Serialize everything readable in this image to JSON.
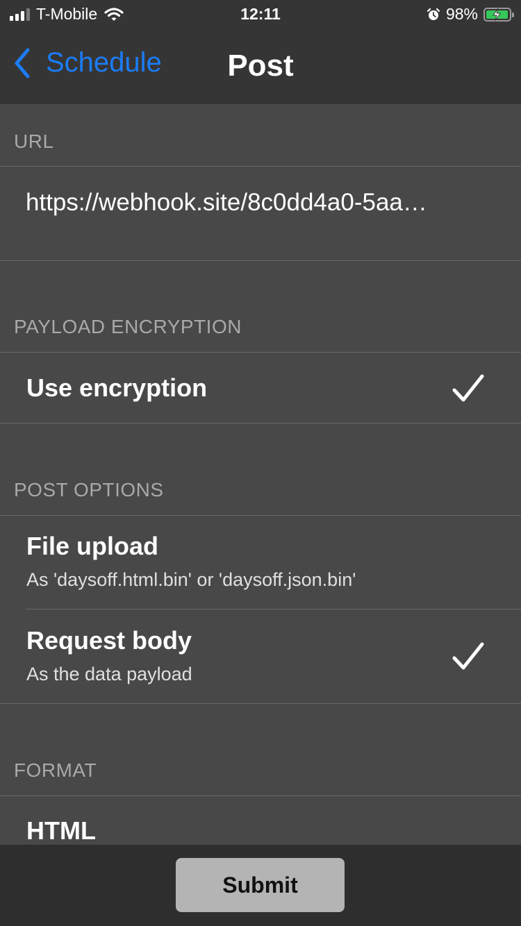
{
  "status_bar": {
    "carrier": "T-Mobile",
    "time": "12:11",
    "battery_percent_text": "98%",
    "battery_level": 0.98,
    "signal_bars": 4,
    "signal_bars_active": 3
  },
  "nav": {
    "back_label": "Schedule",
    "title": "Post"
  },
  "sections": {
    "url": {
      "header": "URL",
      "value": "https://webhook.site/8c0dd4a0-5aa…"
    },
    "encryption": {
      "header": "PAYLOAD ENCRYPTION",
      "use_encryption": {
        "title": "Use encryption",
        "checked": true
      }
    },
    "post_options": {
      "header": "POST OPTIONS",
      "file_upload": {
        "title": "File upload",
        "subtitle": "As 'daysoff.html.bin' or 'daysoff.json.bin'",
        "checked": false
      },
      "request_body": {
        "title": "Request body",
        "subtitle": "As the data payload",
        "checked": true
      }
    },
    "format": {
      "header": "FORMAT",
      "html": {
        "title": "HTML"
      }
    }
  },
  "submit_label": "Submit",
  "colors": {
    "accent": "#1b7cf5",
    "background": "#484848",
    "bar": "#353535",
    "battery": "#35c759"
  }
}
